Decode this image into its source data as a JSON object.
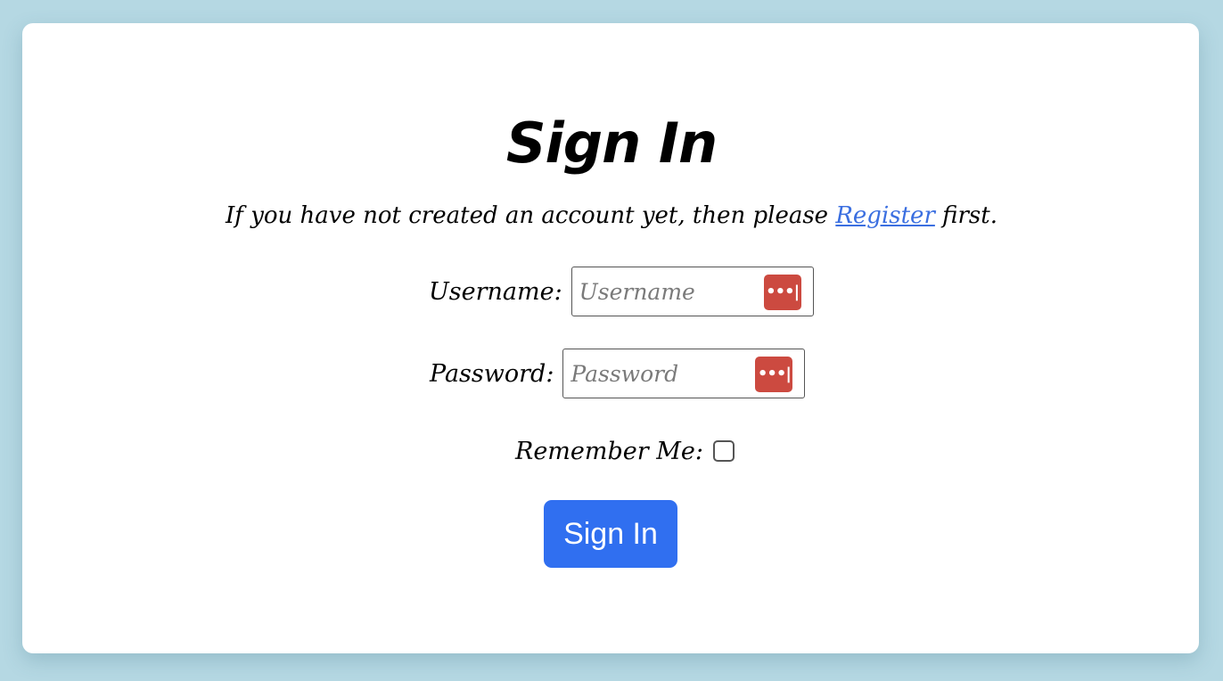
{
  "page": {
    "title": "Sign In",
    "intro_before": "If you have not created an account yet, then please ",
    "register_link": "Register",
    "intro_after": " first."
  },
  "form": {
    "username": {
      "label": "Username:",
      "placeholder": "Username",
      "value": "",
      "icon": "password-manager-icon"
    },
    "password": {
      "label": "Password:",
      "placeholder": "Password",
      "value": "",
      "icon": "password-manager-icon"
    },
    "remember": {
      "label": "Remember Me:",
      "checked": false
    },
    "submit_label": "Sign In",
    "pw_manager_glyph": "•••|"
  },
  "colors": {
    "background": "#b5d8e3",
    "card": "#ffffff",
    "link": "#3b6fe0",
    "button": "#306ff0",
    "password_manager": "#cc4a40"
  }
}
